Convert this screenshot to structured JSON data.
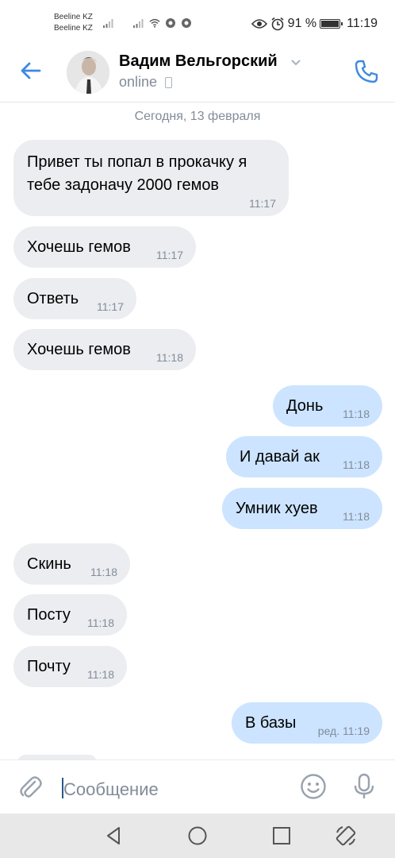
{
  "status_bar": {
    "carrier1": "Beeline KZ",
    "carrier2": "Beeline KZ",
    "battery_text": "91 %",
    "battery_level": 0.91,
    "time": "11:19"
  },
  "header": {
    "name": "Вадим Вельгорский",
    "status": "online"
  },
  "chat": {
    "date_separator": "Сегодня, 13 февраля",
    "messages": [
      {
        "direction": "in",
        "text": "Привет ты попал в прокачку я\nтебе задоначу 2000 гемов",
        "time": "11:17"
      },
      {
        "direction": "in",
        "text": "Хочешь гемов",
        "time": "11:17"
      },
      {
        "direction": "in",
        "text": "Ответь",
        "time": "11:17"
      },
      {
        "direction": "in",
        "text": "Хочешь гемов",
        "time": "11:18"
      },
      {
        "direction": "out",
        "text": "Донь",
        "time": "11:18"
      },
      {
        "direction": "out",
        "text": "И давай ак",
        "time": "11:18"
      },
      {
        "direction": "out",
        "text": "Умник хуев",
        "time": "11:18"
      },
      {
        "direction": "in",
        "text": "Скинь",
        "time": "11:18"
      },
      {
        "direction": "in",
        "text": "Посту",
        "time": "11:18"
      },
      {
        "direction": "in",
        "text": "Почту",
        "time": "11:18"
      },
      {
        "direction": "out",
        "text": "В базы",
        "time": "ред. 11:19"
      }
    ]
  },
  "input": {
    "placeholder": "Сообщение"
  },
  "icons": {
    "back": "arrow-left-icon",
    "call": "phone-icon",
    "attach": "paperclip-icon",
    "emoji": "smile-icon",
    "voice": "microphone-icon",
    "nav_back": "triangle-back-icon",
    "nav_home": "circle-home-icon",
    "nav_recents": "square-recents-icon",
    "nav_rotate": "rotate-screen-icon"
  },
  "colors": {
    "accent": "#3f8ae0",
    "incoming_bubble": "#ebedf0",
    "outgoing_bubble": "#cce4ff",
    "secondary_text": "#818c99"
  }
}
